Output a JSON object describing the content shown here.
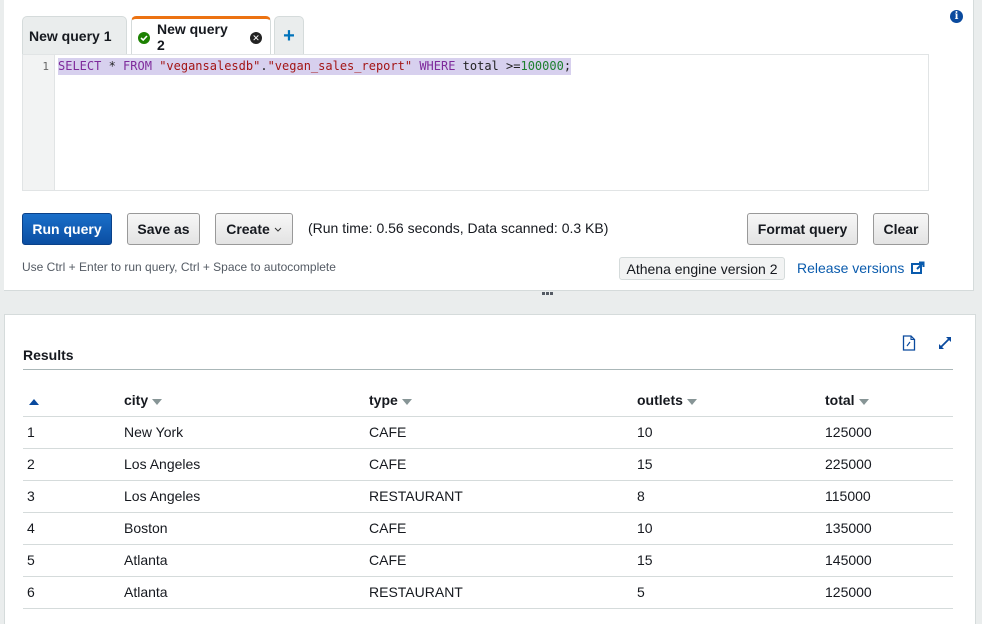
{
  "tabs": [
    {
      "label": "New query 1",
      "active": false
    },
    {
      "label": "New query 2",
      "active": true,
      "status": "success"
    },
    {
      "label": "+",
      "role": "new-tab"
    }
  ],
  "editor": {
    "line_number": "1",
    "tokens": [
      {
        "t": "kw",
        "v": "SELECT"
      },
      {
        "t": "id",
        "v": " * "
      },
      {
        "t": "kw",
        "v": "FROM"
      },
      {
        "t": "id",
        "v": " "
      },
      {
        "t": "str",
        "v": "\"vegansalesdb\""
      },
      {
        "t": "id",
        "v": "."
      },
      {
        "t": "str",
        "v": "\"vegan_sales_report\""
      },
      {
        "t": "id",
        "v": " "
      },
      {
        "t": "kw",
        "v": "WHERE"
      },
      {
        "t": "id",
        "v": " total >="
      },
      {
        "t": "num",
        "v": "100000"
      },
      {
        "t": "id",
        "v": ";"
      }
    ]
  },
  "toolbar": {
    "run_label": "Run query",
    "save_label": "Save as",
    "create_label": "Create",
    "run_meta": "(Run time: 0.56 seconds, Data scanned: 0.3 KB)",
    "format_label": "Format query",
    "clear_label": "Clear",
    "hint": "Use Ctrl + Enter to run query, Ctrl + Space to autocomplete",
    "engine": "Athena engine version 2",
    "release_link": "Release versions"
  },
  "results": {
    "title": "Results",
    "columns": [
      "city",
      "type",
      "outlets",
      "total"
    ],
    "rows": [
      [
        "1",
        "New York",
        "CAFE",
        "10",
        "125000"
      ],
      [
        "2",
        "Los Angeles",
        "CAFE",
        "15",
        "225000"
      ],
      [
        "3",
        "Los Angeles",
        "RESTAURANT",
        "8",
        "115000"
      ],
      [
        "4",
        "Boston",
        "CAFE",
        "10",
        "135000"
      ],
      [
        "5",
        "Atlanta",
        "CAFE",
        "15",
        "145000"
      ],
      [
        "6",
        "Atlanta",
        "RESTAURANT",
        "5",
        "125000"
      ]
    ]
  },
  "colors": {
    "accent_tab": "#ec7211",
    "primary_button": "#0b4ea2",
    "link": "#0a5bad",
    "success": "#1d8102"
  }
}
